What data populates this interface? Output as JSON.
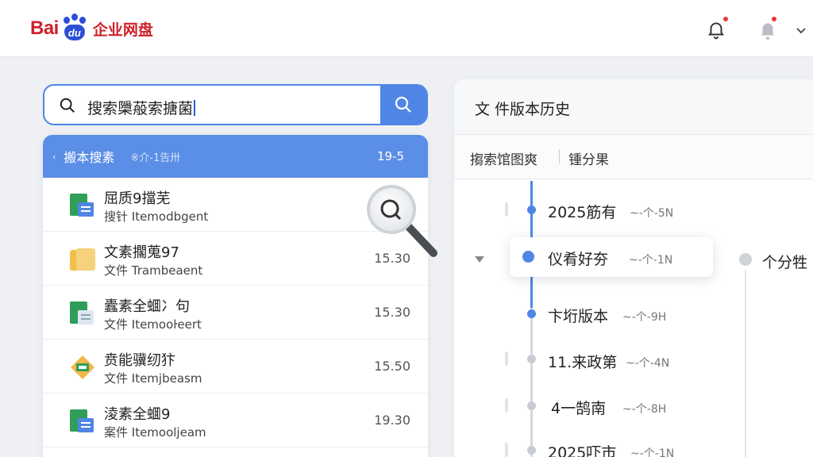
{
  "header": {
    "logo_text": "Bai",
    "logo_paw_text": "du",
    "product_name": "企业网盘",
    "icons": [
      "bell-icon",
      "app-icon",
      "chevron-down-icon"
    ],
    "accent": "#4f86e6",
    "brand_red": "#d0212a"
  },
  "search": {
    "value": "搜索檃蒰索搪菌",
    "icon": "search-icon"
  },
  "list": {
    "header": {
      "title": "搬本搜素",
      "sub": "※介-1告卅",
      "num": "19-5"
    },
    "rows": [
      {
        "name": "屈质9擋芜",
        "meta": "搜针 Itemodbgent",
        "time": "",
        "icon": "doc-green-icon"
      },
      {
        "name": "文素擱蒐97",
        "meta": "文件 Trambeaent",
        "time": "15.30",
        "icon": "folder-icon"
      },
      {
        "name": "蠹素全蜖冫句",
        "meta": "文件 Itemooŀeert",
        "time": "15.30",
        "icon": "doc-green-icon"
      },
      {
        "name": "贲能骥纫犿",
        "meta": "文件 Itemjbeasm",
        "time": "15.50",
        "icon": "box-icon"
      },
      {
        "name": "淩素全蜖9",
        "meta": "案件 Itemooljeam",
        "time": "19.30",
        "icon": "doc-green-icon"
      }
    ]
  },
  "history": {
    "title": "文 件版本历史",
    "filter_a": "搊索馆图爽",
    "filter_b": "锺分果",
    "entries": [
      {
        "label": "2025筋有",
        "sub": "~-个-5N",
        "dot": "blue"
      },
      {
        "label": "仪肴好夯",
        "sub": "~-个-1N",
        "dot": "blue",
        "highlight": true
      },
      {
        "label": "卞垳版本",
        "sub": "~-个-9H",
        "dot": "blue"
      },
      {
        "label": "11.来政第",
        "sub": "~-个-4N",
        "dot": "gray"
      },
      {
        "label": "4一鹄南",
        "sub": "~-个-8H",
        "dot": "gray"
      },
      {
        "label": "2025吓市",
        "sub": "~-个-1N",
        "dot": "gray"
      }
    ],
    "side_label": "个分牲"
  }
}
